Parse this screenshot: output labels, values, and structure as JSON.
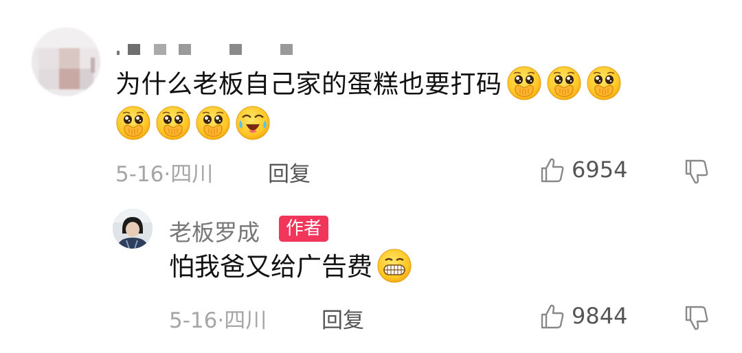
{
  "comment": {
    "text": "为什么老板自己家的蛋糕也要打码",
    "emojis": [
      "cover-mouth-emoji",
      "cover-mouth-emoji",
      "cover-mouth-emoji",
      "cover-mouth-emoji",
      "cover-mouth-emoji",
      "cover-mouth-emoji",
      "laugh-cry-emoji"
    ],
    "date": "5-16",
    "separator": "·",
    "location": "四川",
    "reply_label": "回复",
    "likes": "6954"
  },
  "reply": {
    "author": "老板罗成",
    "author_badge": "作者",
    "text": "怕我爸又给广告费",
    "emoji": "grin-emoji",
    "date": "5-16",
    "separator": "·",
    "location": "四川",
    "reply_label": "回复",
    "likes": "9844"
  },
  "colors": {
    "meta_text": "#a6a6a6",
    "action_text": "#555555",
    "badge": "#f2355b",
    "emoji_face": "#ffd43b"
  },
  "icons": {
    "like": "thumbs-up-icon",
    "dislike": "thumbs-down-icon"
  }
}
